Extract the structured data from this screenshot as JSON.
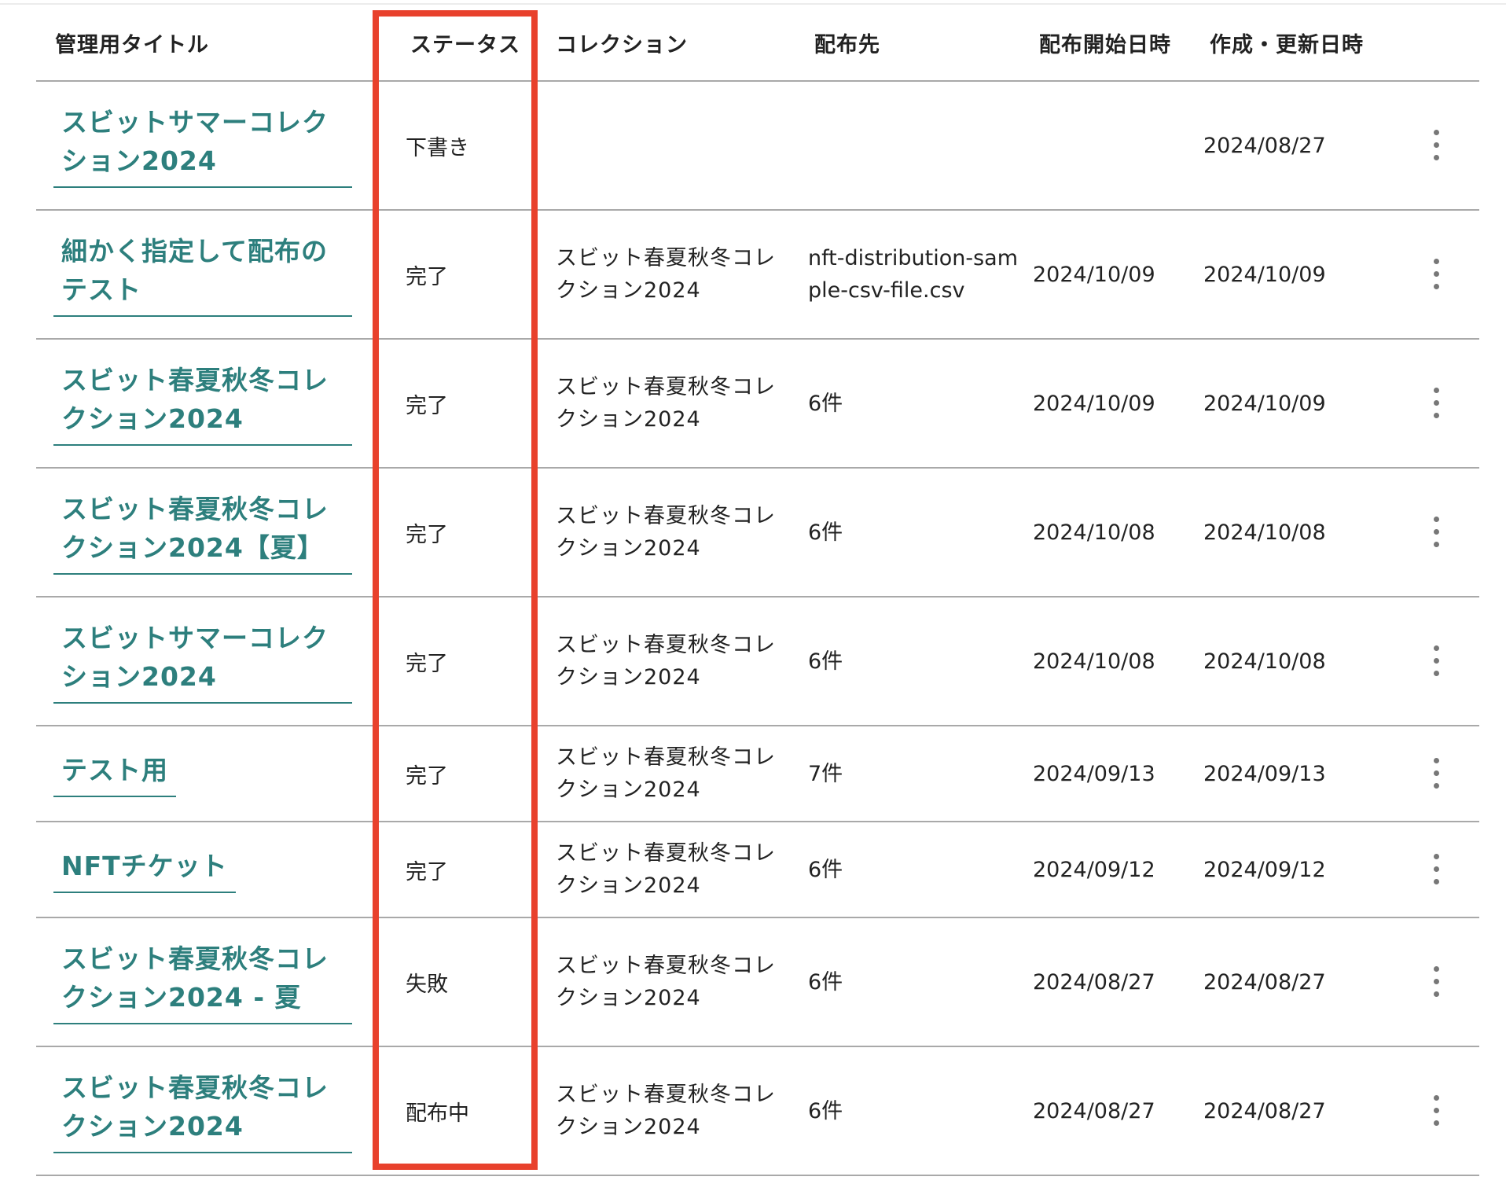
{
  "table": {
    "headers": {
      "title": "管理用タイトル",
      "status": "ステータス",
      "collection": "コレクション",
      "destination": "配布先",
      "start": "配布開始日時",
      "updated": "作成・更新日時"
    },
    "rows": [
      {
        "title": "スビットサマーコレクション2024",
        "status": "下書き",
        "collection": "",
        "destination": "",
        "start": "",
        "updated": "2024/08/27"
      },
      {
        "title": "細かく指定して配布のテスト",
        "status": "完了",
        "collection": "スビット春夏秋冬コレクション2024",
        "destination": "nft-distribution-sample-csv-file.csv",
        "start": "2024/10/09",
        "updated": "2024/10/09"
      },
      {
        "title": "スビット春夏秋冬コレクション2024",
        "status": "完了",
        "collection": "スビット春夏秋冬コレクション2024",
        "destination": "6件",
        "start": "2024/10/09",
        "updated": "2024/10/09"
      },
      {
        "title": "スビット春夏秋冬コレクション2024【夏】",
        "status": "完了",
        "collection": "スビット春夏秋冬コレクション2024",
        "destination": "6件",
        "start": "2024/10/08",
        "updated": "2024/10/08"
      },
      {
        "title": "スビットサマーコレクション2024",
        "status": "完了",
        "collection": "スビット春夏秋冬コレクション2024",
        "destination": "6件",
        "start": "2024/10/08",
        "updated": "2024/10/08"
      },
      {
        "title": "テスト用",
        "status": "完了",
        "collection": "スビット春夏秋冬コレクション2024",
        "destination": "7件",
        "start": "2024/09/13",
        "updated": "2024/09/13"
      },
      {
        "title": "NFTチケット",
        "status": "完了",
        "collection": "スビット春夏秋冬コレクション2024",
        "destination": "6件",
        "start": "2024/09/12",
        "updated": "2024/09/12"
      },
      {
        "title": "スビット春夏秋冬コレクション2024 - 夏",
        "status": "失敗",
        "collection": "スビット春夏秋冬コレクション2024",
        "destination": "6件",
        "start": "2024/08/27",
        "updated": "2024/08/27"
      },
      {
        "title": "スビット春夏秋冬コレクション2024",
        "status": "配布中",
        "collection": "スビット春夏秋冬コレクション2024",
        "destination": "6件",
        "start": "2024/08/27",
        "updated": "2024/08/27"
      }
    ]
  },
  "colors": {
    "link": "#2d7f7d",
    "highlight": "#e8412c",
    "divider": "#a9a9a9",
    "kebab": "#777777"
  },
  "icons": {
    "row_menu": "more-vertical-icon"
  }
}
